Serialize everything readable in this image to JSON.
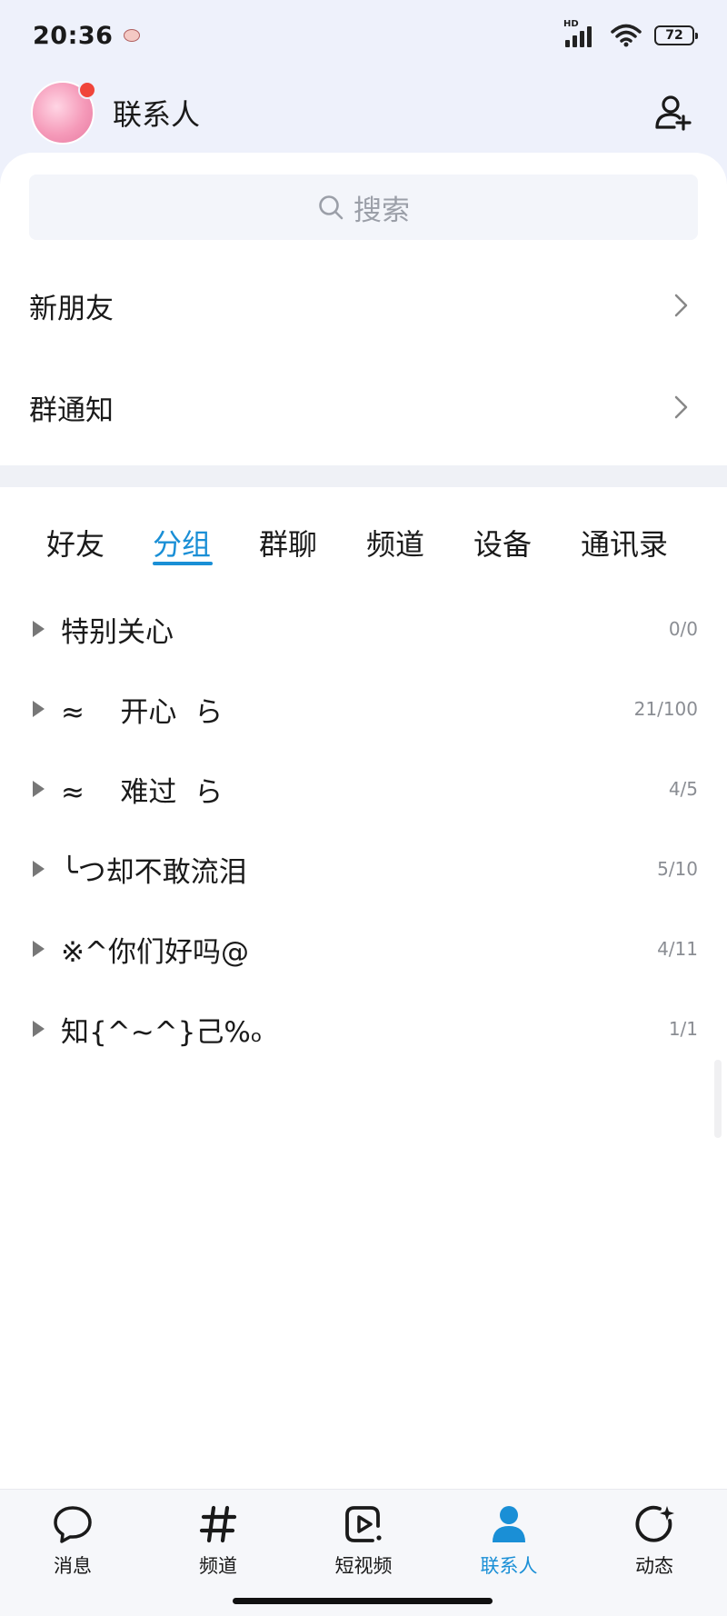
{
  "status_bar": {
    "time": "20:36",
    "network": "HD",
    "battery": "72"
  },
  "header": {
    "title": "联系人",
    "avatar_badge_color": "#f0453a"
  },
  "search": {
    "placeholder": "搜索"
  },
  "menu": [
    {
      "label": "新朋友"
    },
    {
      "label": "群通知"
    }
  ],
  "tabs": [
    {
      "label": "好友",
      "active": false
    },
    {
      "label": "分组",
      "active": true
    },
    {
      "label": "群聊",
      "active": false
    },
    {
      "label": "频道",
      "active": false
    },
    {
      "label": "设备",
      "active": false
    },
    {
      "label": "通讯录",
      "active": false
    }
  ],
  "groups": [
    {
      "name": "特别关心",
      "count": "0/0"
    },
    {
      "name": "≈    开心  ら",
      "count": "21/100"
    },
    {
      "name": "≈    难过  ら",
      "count": "4/5"
    },
    {
      "name": "╰つ却不敢流泪",
      "count": "5/10"
    },
    {
      "name": "※^你们好吗@",
      "count": "4/11"
    },
    {
      "name": "知{^~^}己%ₒ",
      "count": "1/1"
    }
  ],
  "bottom_nav": [
    {
      "label": "消息",
      "icon": "chat-bubble-icon",
      "active": false
    },
    {
      "label": "频道",
      "icon": "hashtag-icon",
      "active": false
    },
    {
      "label": "短视频",
      "icon": "video-play-icon",
      "active": false
    },
    {
      "label": "联系人",
      "icon": "person-icon",
      "active": true
    },
    {
      "label": "动态",
      "icon": "star-refresh-icon",
      "active": false
    }
  ],
  "colors": {
    "accent": "#1a8fd6",
    "background": "#eef1fb"
  }
}
